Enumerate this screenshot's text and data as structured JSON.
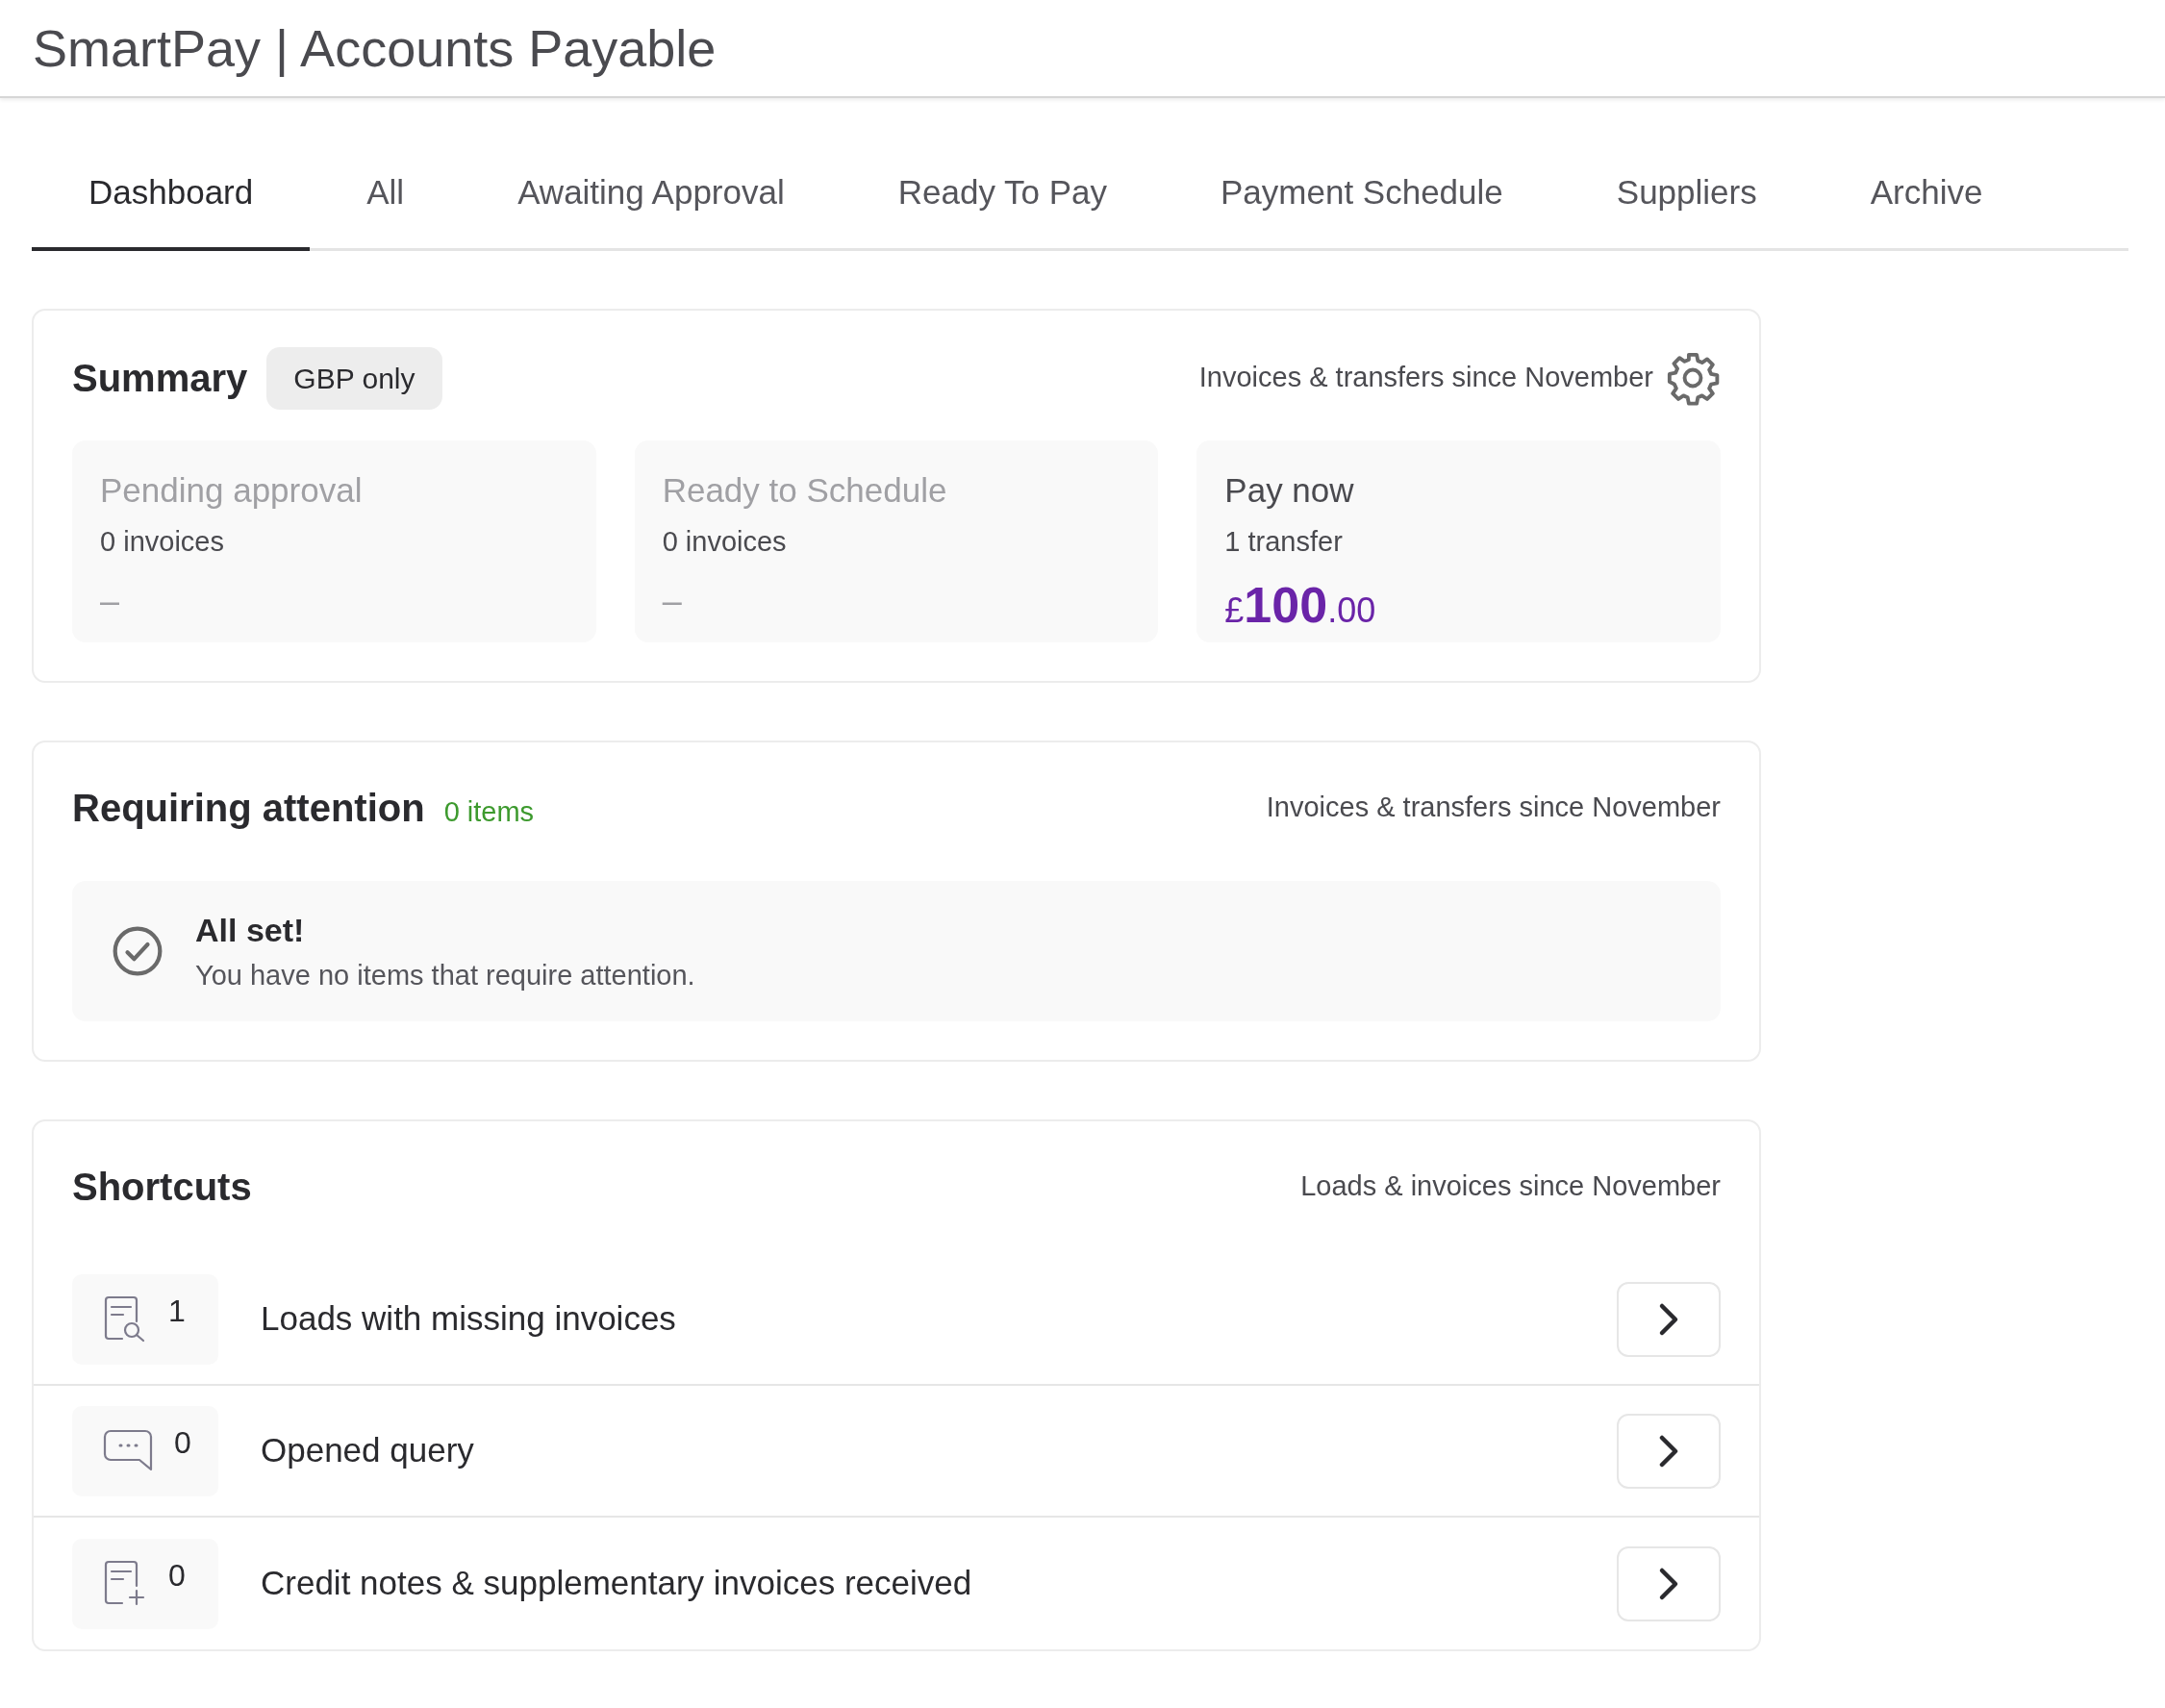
{
  "header": {
    "title": "SmartPay | Accounts Payable"
  },
  "tabs": [
    {
      "label": "Dashboard",
      "selected": true
    },
    {
      "label": "All",
      "selected": false
    },
    {
      "label": "Awaiting Approval",
      "selected": false
    },
    {
      "label": "Ready To Pay",
      "selected": false
    },
    {
      "label": "Payment Schedule",
      "selected": false
    },
    {
      "label": "Suppliers",
      "selected": false
    },
    {
      "label": "Archive",
      "selected": false
    }
  ],
  "summary": {
    "title": "Summary",
    "badge": "GBP only",
    "note": "Invoices & transfers since November",
    "cards": [
      {
        "title": "Pending approval",
        "count": "0 invoices",
        "active": false,
        "empty": "–"
      },
      {
        "title": "Ready to Schedule",
        "count": "0 invoices",
        "active": false,
        "empty": "–"
      },
      {
        "title": "Pay now",
        "count": "1 transfer",
        "active": true,
        "currency": "£",
        "whole": "100",
        "fraction": ".00"
      }
    ]
  },
  "attention": {
    "title": "Requiring attention",
    "count": "0 items",
    "note": "Invoices & transfers since November",
    "status_title": "All set!",
    "status_text": "You have no items that require attention."
  },
  "shortcuts": {
    "title": "Shortcuts",
    "note": "Loads & invoices since November",
    "items": [
      {
        "kind": "search-doc",
        "count": "1",
        "label": "Loads with missing invoices"
      },
      {
        "kind": "chat",
        "count": "0",
        "label": "Opened query"
      },
      {
        "kind": "doc-plus",
        "count": "0",
        "label": "Credit notes & supplementary invoices received"
      }
    ]
  }
}
